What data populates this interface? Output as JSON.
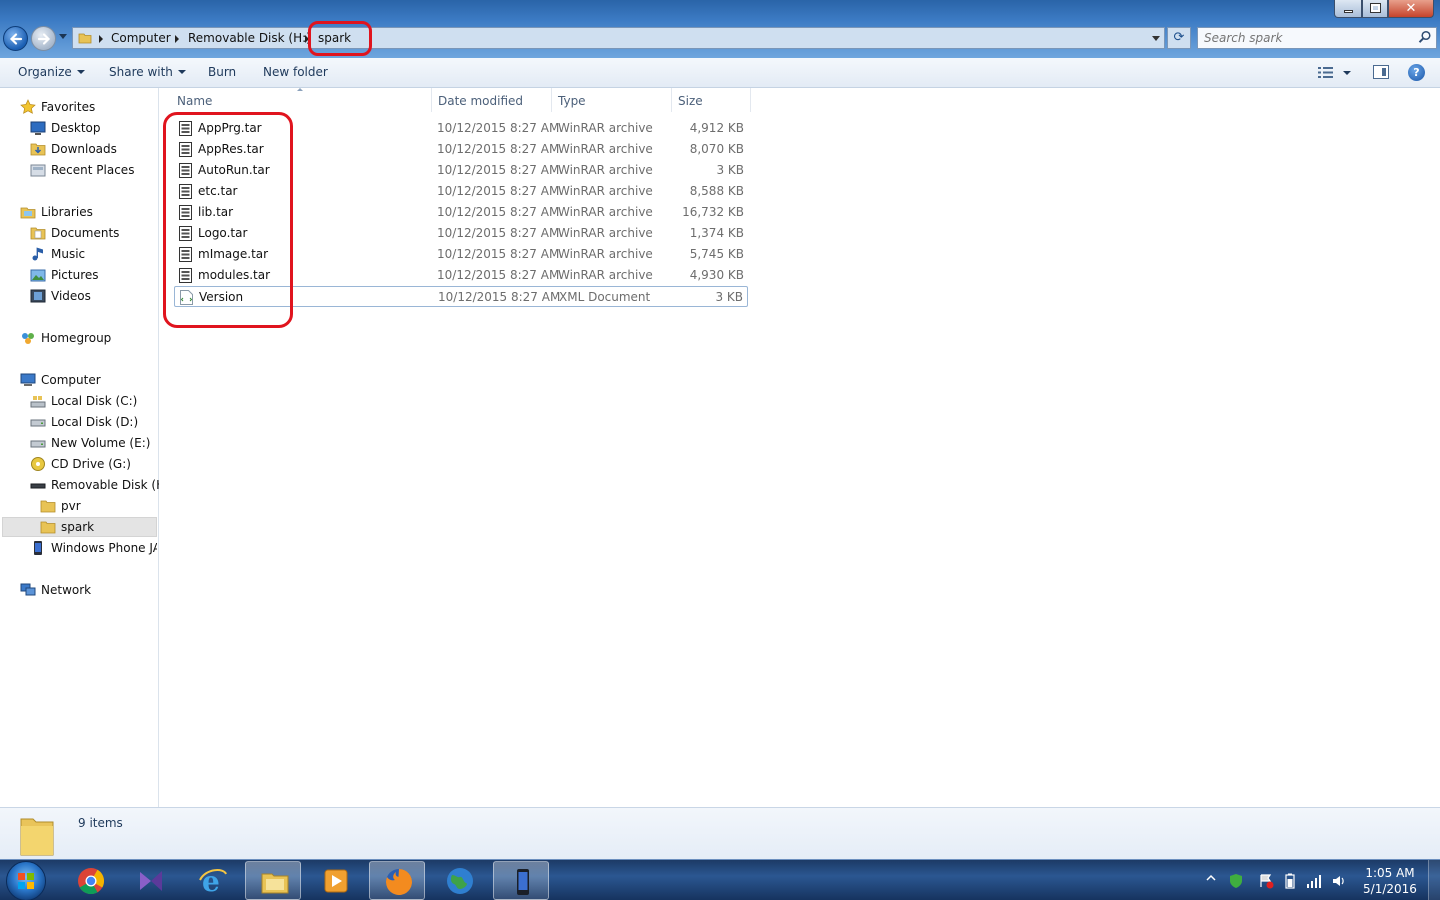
{
  "window": {
    "breadcrumbs": [
      "Computer",
      "Removable Disk (H:)",
      "spark"
    ],
    "search_placeholder": "Search spark"
  },
  "toolbar": {
    "organize": "Organize",
    "share_with": "Share with",
    "burn": "Burn",
    "new_folder": "New folder"
  },
  "nav": {
    "favorites": "Favorites",
    "desktop": "Desktop",
    "downloads": "Downloads",
    "recent_places": "Recent Places",
    "libraries": "Libraries",
    "documents": "Documents",
    "music": "Music",
    "pictures": "Pictures",
    "videos": "Videos",
    "homegroup": "Homegroup",
    "computer": "Computer",
    "local_c": "Local Disk (C:)",
    "local_d": "Local Disk (D:)",
    "new_volume_e": "New Volume (E:)",
    "cd_drive_g": "CD Drive (G:)",
    "removable_h": "Removable Disk (H:)",
    "pvr": "pvr",
    "spark": "spark",
    "windows_phone": "Windows Phone JAH",
    "network": "Network"
  },
  "columns": {
    "name": "Name",
    "date_modified": "Date modified",
    "type": "Type",
    "size": "Size"
  },
  "files": [
    {
      "name": "AppPrg.tar",
      "date": "10/12/2015 8:27 AM",
      "type": "WinRAR archive",
      "size": "4,912 KB"
    },
    {
      "name": "AppRes.tar",
      "date": "10/12/2015 8:27 AM",
      "type": "WinRAR archive",
      "size": "8,070 KB"
    },
    {
      "name": "AutoRun.tar",
      "date": "10/12/2015 8:27 AM",
      "type": "WinRAR archive",
      "size": "3 KB"
    },
    {
      "name": "etc.tar",
      "date": "10/12/2015 8:27 AM",
      "type": "WinRAR archive",
      "size": "8,588 KB"
    },
    {
      "name": "lib.tar",
      "date": "10/12/2015 8:27 AM",
      "type": "WinRAR archive",
      "size": "16,732 KB"
    },
    {
      "name": "Logo.tar",
      "date": "10/12/2015 8:27 AM",
      "type": "WinRAR archive",
      "size": "1,374 KB"
    },
    {
      "name": "mImage.tar",
      "date": "10/12/2015 8:27 AM",
      "type": "WinRAR archive",
      "size": "5,745 KB"
    },
    {
      "name": "modules.tar",
      "date": "10/12/2015 8:27 AM",
      "type": "WinRAR archive",
      "size": "4,930 KB"
    },
    {
      "name": "Version",
      "date": "10/12/2015 8:27 AM",
      "type": "XML Document",
      "size": "3 KB"
    }
  ],
  "status": {
    "item_count": "9 items"
  },
  "taskbar": {
    "time": "1:05 AM",
    "date": "5/1/2016"
  },
  "colors": {
    "annotation_ring": "#e0141e",
    "accent": "#2a64a8"
  }
}
